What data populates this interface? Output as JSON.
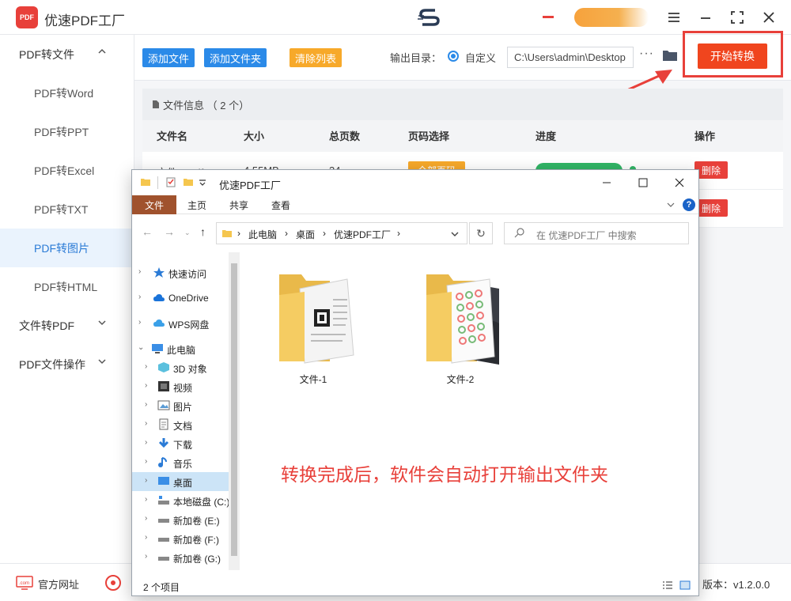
{
  "app": {
    "title": "优速PDF工厂",
    "logo_text": "PDF",
    "window_controls": [
      "menu-icon",
      "minimize-icon",
      "fullscreen-icon",
      "close-icon"
    ]
  },
  "sidebar": {
    "groups": [
      {
        "label": "PDF转文件",
        "expanded": true,
        "items": [
          "PDF转Word",
          "PDF转PPT",
          "PDF转Excel",
          "PDF转TXT",
          "PDF转图片",
          "PDF转HTML"
        ]
      },
      {
        "label": "文件转PDF",
        "expanded": false
      },
      {
        "label": "PDF文件操作",
        "expanded": false
      }
    ],
    "active_item": "PDF转图片"
  },
  "toolbar": {
    "add_file": "添加文件",
    "add_folder": "添加文件夹",
    "clear_list": "清除列表",
    "output_label": "输出目录：",
    "radio_custom": "自定义",
    "output_path": "C:\\Users\\admin\\Desktop",
    "more": "···",
    "start": "开始转换"
  },
  "file_table": {
    "info": "文件信息 （ 2 个）",
    "headers": [
      "文件名",
      "大小",
      "总页数",
      "页码选择",
      "进度",
      "操作"
    ],
    "rows": [
      {
        "name": "文件-1.pdf",
        "size": "4.55MB",
        "pages": "34",
        "page_select": "全部页码",
        "action": "删除"
      },
      {
        "name": "",
        "size": "",
        "pages": "",
        "page_select": "",
        "action": "删除"
      }
    ]
  },
  "footer": {
    "website": "官方网址",
    "version": "版本：v1.2.0.0"
  },
  "explorer": {
    "title": "优速PDF工厂",
    "ribbon_tabs": [
      "文件",
      "主页",
      "共享",
      "查看"
    ],
    "help": "?",
    "breadcrumbs": [
      "此电脑",
      "桌面",
      "优速PDF工厂"
    ],
    "search_placeholder": "在 优速PDF工厂 中搜索",
    "nav": [
      {
        "label": "快速访问",
        "level": 0,
        "icon": "star-icon"
      },
      {
        "label": "OneDrive",
        "level": 0,
        "icon": "cloud-icon"
      },
      {
        "label": "WPS网盘",
        "level": 0,
        "icon": "wps-cloud-icon"
      },
      {
        "label": "此电脑",
        "level": 0,
        "icon": "computer-icon",
        "expanded": true
      },
      {
        "label": "3D 对象",
        "level": 1,
        "icon": "cube-icon"
      },
      {
        "label": "视频",
        "level": 1,
        "icon": "video-icon"
      },
      {
        "label": "图片",
        "level": 1,
        "icon": "picture-icon"
      },
      {
        "label": "文档",
        "level": 1,
        "icon": "document-icon"
      },
      {
        "label": "下载",
        "level": 1,
        "icon": "download-icon"
      },
      {
        "label": "音乐",
        "level": 1,
        "icon": "music-icon"
      },
      {
        "label": "桌面",
        "level": 1,
        "icon": "desktop-icon",
        "selected": true
      },
      {
        "label": "本地磁盘 (C:)",
        "level": 1,
        "icon": "drive-icon"
      },
      {
        "label": "新加卷 (E:)",
        "level": 1,
        "icon": "drive-icon"
      },
      {
        "label": "新加卷 (F:)",
        "level": 1,
        "icon": "drive-icon"
      },
      {
        "label": "新加卷 (G:)",
        "level": 1,
        "icon": "drive-icon"
      }
    ],
    "folders": [
      "文件-1",
      "文件-2"
    ],
    "notice": "转换完成后，软件会自动打开输出文件夹",
    "status": "2 个项目"
  },
  "colors": {
    "accent_blue": "#2b8ae8",
    "accent_orange": "#f7a92a",
    "accent_red": "#e8403a",
    "progress_green": "#31b566"
  }
}
